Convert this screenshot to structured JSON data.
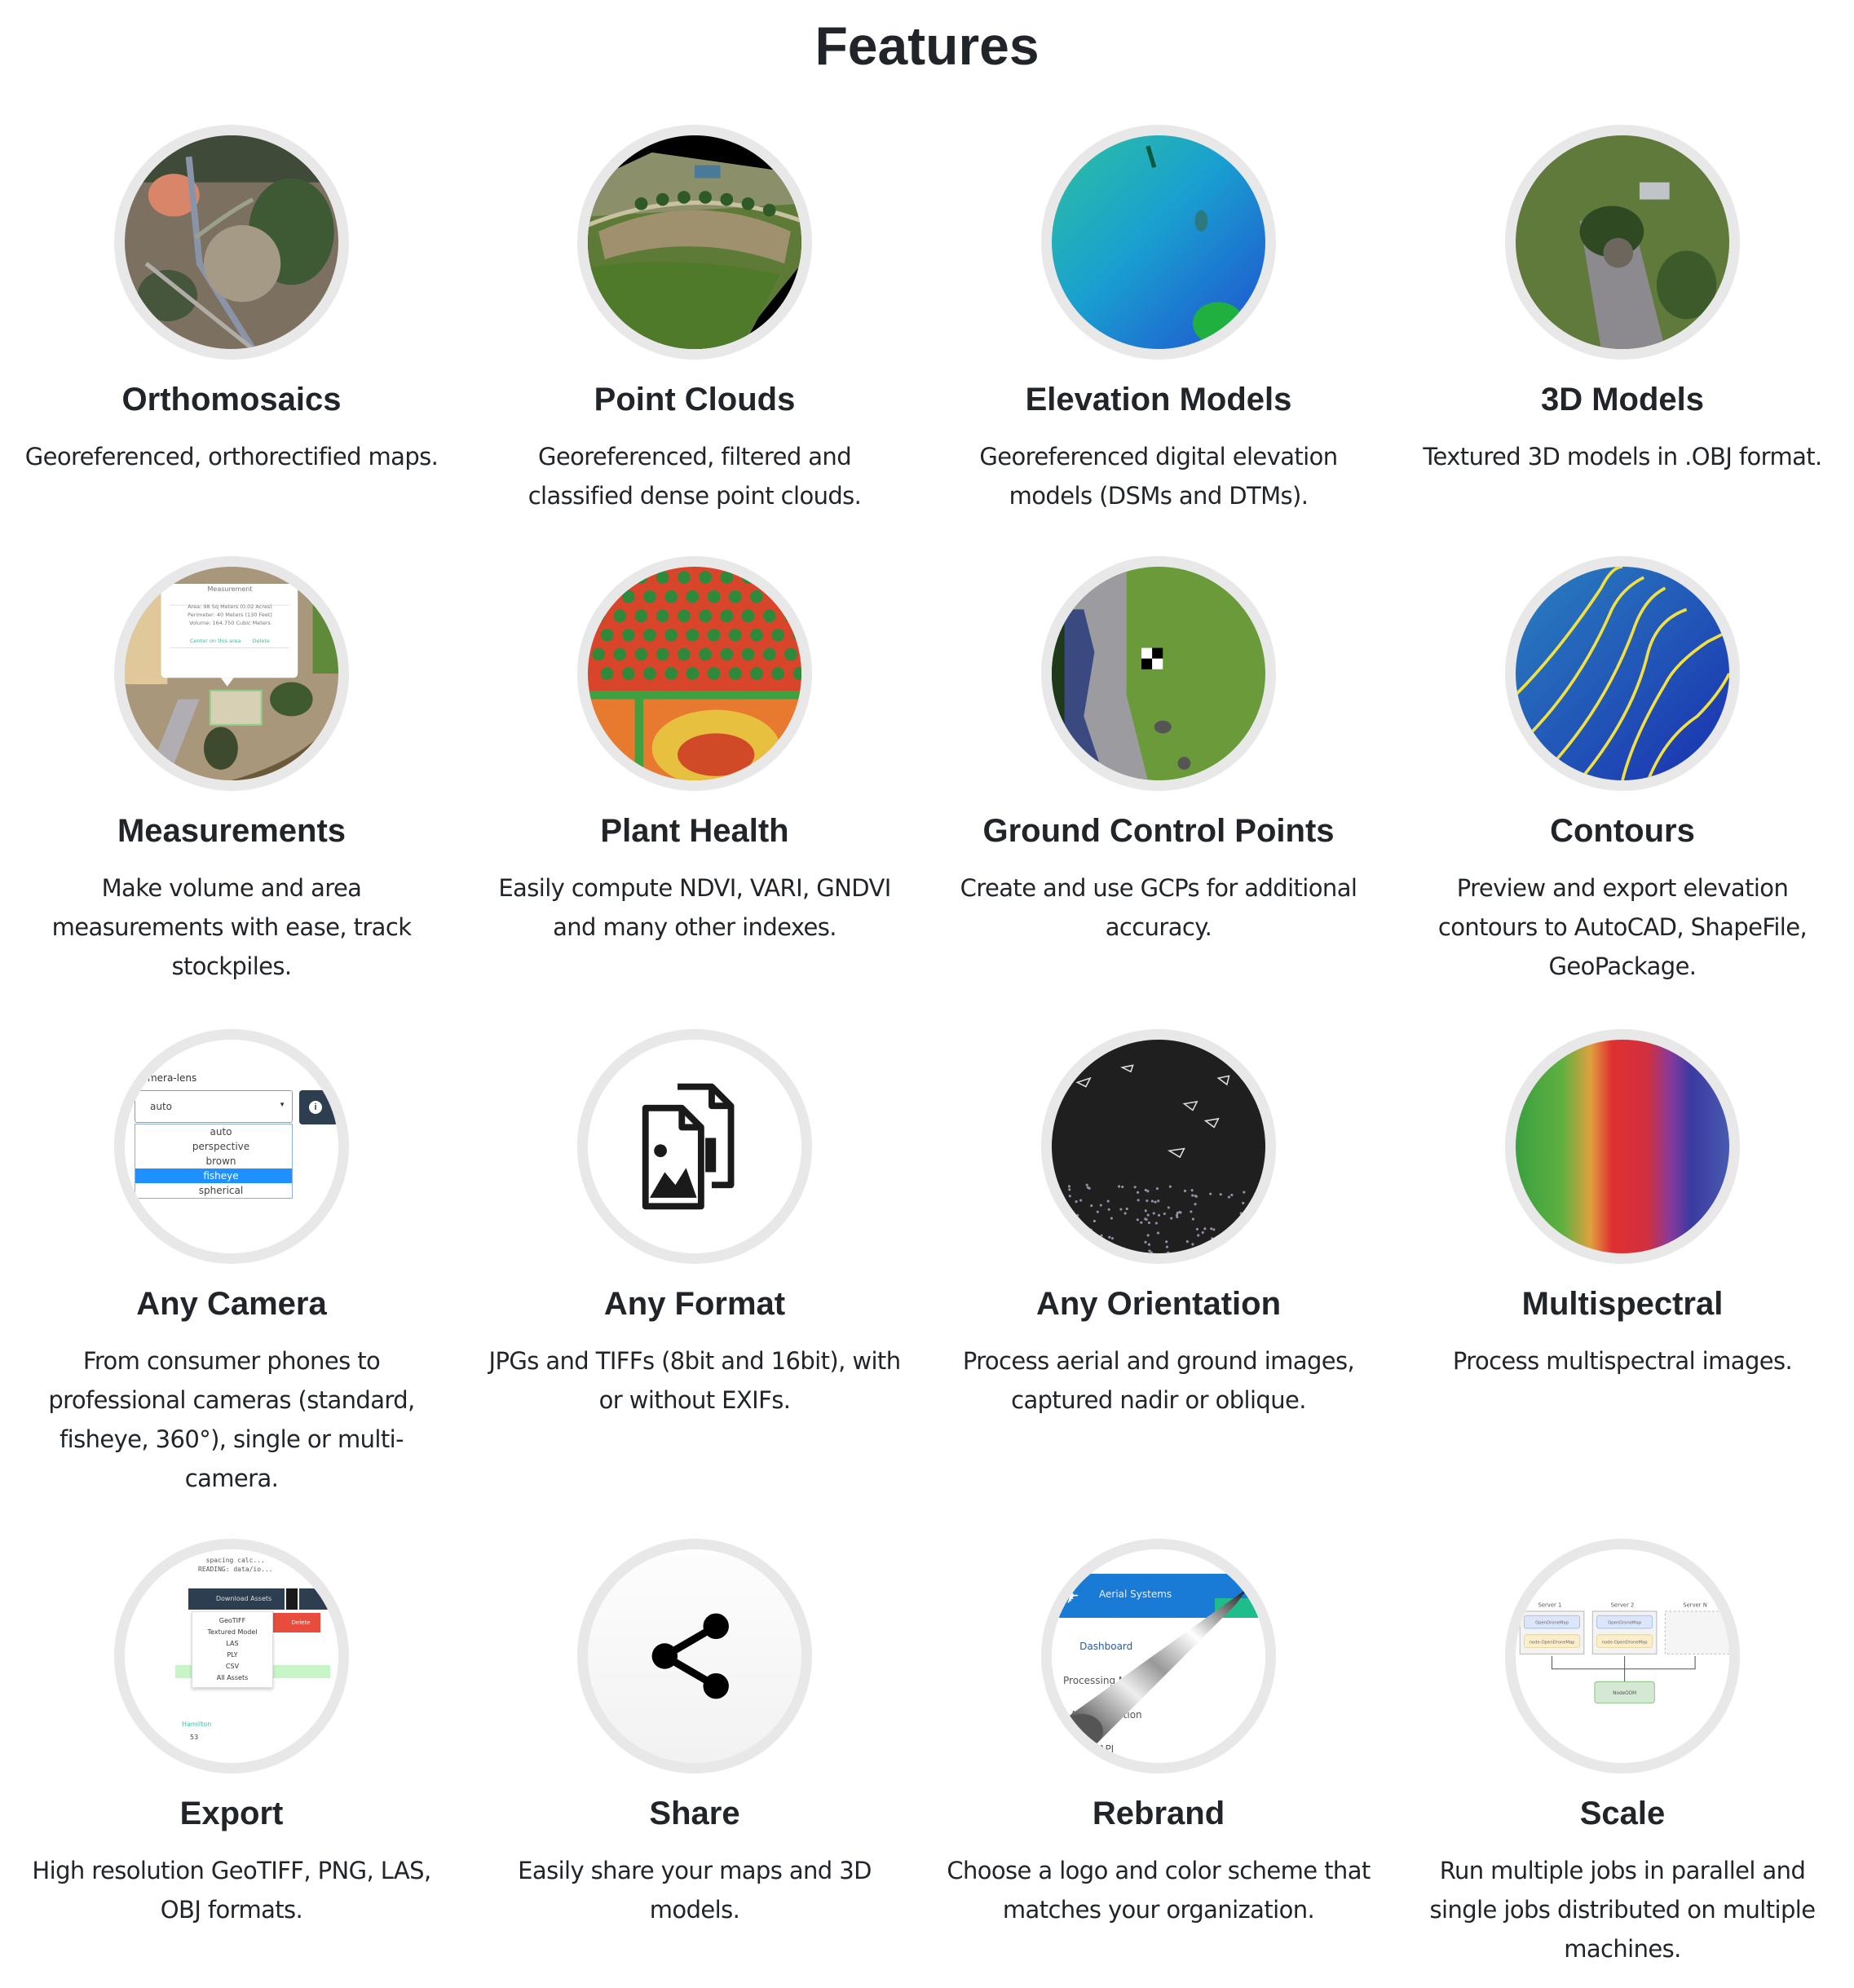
{
  "page": {
    "title": "Features"
  },
  "features": [
    {
      "title": "Orthomosaics",
      "description": "Georeferenced, orthorectified maps.",
      "image": "aerial-orthophoto"
    },
    {
      "title": "Point Clouds",
      "description": "Georeferenced, filtered and classified dense point clouds.",
      "image": "point-cloud-render"
    },
    {
      "title": "Elevation Models",
      "description": "Georeferenced digital elevation models (DSMs and DTMs).",
      "image": "elevation-hillshade"
    },
    {
      "title": "3D Models",
      "description": "Textured 3D models in .OBJ format.",
      "image": "textured-3d-model"
    },
    {
      "title": "Measurements",
      "description": "Make volume and area measurements with ease, track stockpiles.",
      "image": "measurement-popup",
      "popup": {
        "heading": "Measurement",
        "lines": [
          "Area: 98 Sq Meters (0.02 Acres)",
          "Perimeter: 40 Meters (130 Feet)",
          "Volume: 164.750 Cubic Meters"
        ],
        "actions": [
          "Center on this area",
          "Delete"
        ]
      }
    },
    {
      "title": "Plant Health",
      "description": "Easily compute NDVI, VARI, GNDVI and many other indexes.",
      "image": "ndvi-map"
    },
    {
      "title": "Ground Control Points",
      "description": "Create and use GCPs for additional accuracy.",
      "image": "gcp-target"
    },
    {
      "title": "Contours",
      "description": "Preview and export elevation contours to AutoCAD, ShapeFile, GeoPackage.",
      "image": "contour-lines"
    },
    {
      "title": "Any Camera",
      "description": "From consumer phones to professional cameras (standard, fisheye, 360°), single or multi-camera.",
      "image": "camera-lens-select",
      "select": {
        "label": "camera-lens",
        "value": "auto",
        "options": [
          "auto",
          "perspective",
          "brown",
          "fisheye",
          "spherical"
        ],
        "highlighted": "fisheye"
      }
    },
    {
      "title": "Any Format",
      "description": "JPGs and TIFFs (8bit and 16bit), with or without EXIFs.",
      "image": "file-images-icon"
    },
    {
      "title": "Any Orientation",
      "description": "Process aerial and ground images, captured nadir or oblique.",
      "image": "camera-poses"
    },
    {
      "title": "Multispectral",
      "description": "Process multispectral images.",
      "image": "multispectral-band"
    },
    {
      "title": "Export",
      "description": "High resolution GeoTIFF, PNG, LAS, OBJ formats.",
      "image": "download-menu",
      "menu": {
        "code_lines": [
          "spacing calc...",
          "READING:  data/io..."
        ],
        "button": "Download Assets",
        "delete": "Delete",
        "items": [
          "GeoTIFF",
          "Textured Model",
          "LAS",
          "PLY",
          "CSV",
          "All Assets"
        ],
        "project": "Hamilton",
        "count": "53"
      }
    },
    {
      "title": "Share",
      "description": "Easily share your maps and 3D models.",
      "image": "share-icon"
    },
    {
      "title": "Rebrand",
      "description": "Choose a logo and color scheme that matches your organization.",
      "image": "page-curl",
      "nav": {
        "brand": "Aerial Systems",
        "items": [
          "Dashboard",
          "Processing Nodes",
          "Administration",
          "API"
        ]
      }
    },
    {
      "title": "Scale",
      "description": "Run multiple jobs in parallel and single jobs distributed on multiple machines.",
      "image": "cluster-diagram",
      "diagram": {
        "servers": [
          "Server 1",
          "Server 2",
          "Server N"
        ],
        "apps": [
          "OpenDroneMap",
          "node-OpenDroneMap"
        ],
        "hub": "NodeODM"
      }
    }
  ],
  "colors": {
    "text": "#212529",
    "ring": "#e8e8e8",
    "select_highlight": "#1e90ff",
    "brand_blue": "#1a7bd6",
    "delete_red": "#e74c3c"
  }
}
